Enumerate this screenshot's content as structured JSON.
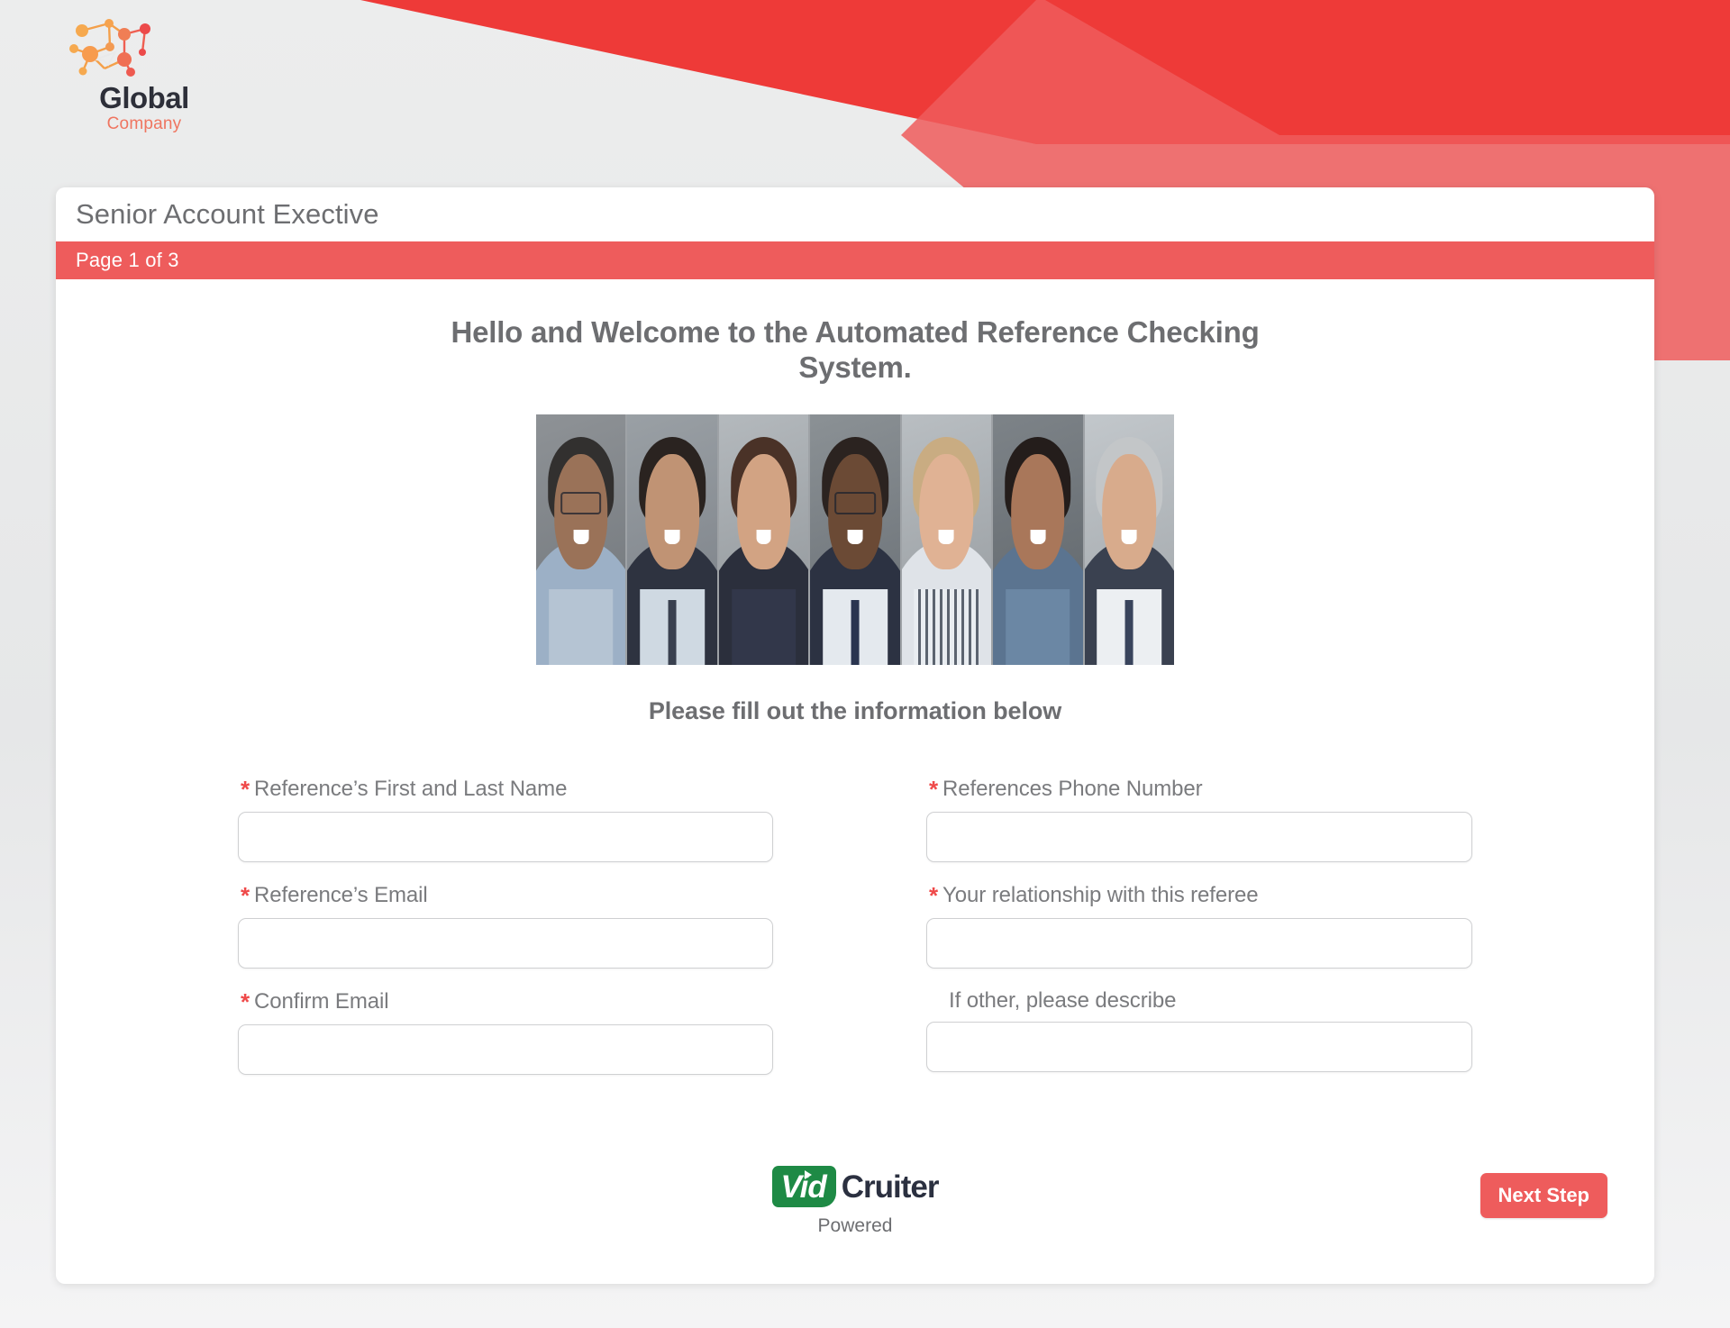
{
  "brand": {
    "logo_icon": "network-nodes-icon",
    "name_primary": "Global",
    "name_secondary": "Company",
    "primary_color": "#2d2f39",
    "secondary_color": "#ef7560"
  },
  "decor": {
    "banner_red": "#ee3a38",
    "banner_coral": "#ee5c5c"
  },
  "card": {
    "title": "Senior Account Exective",
    "page_indicator": "Page 1 of 3",
    "page_indicator_color": "#ee5c5c"
  },
  "content": {
    "welcome_heading": "Hello and Welcome to the Automated Reference Checking System.",
    "collage_alt": "portrait-collage",
    "fill_subheading": "Please fill out the information below"
  },
  "form": {
    "required_marker": "*",
    "fields": [
      {
        "name": "reference-name",
        "label": "Reference’s First and Last Name",
        "required": true,
        "value": "",
        "placeholder": ""
      },
      {
        "name": "reference-phone",
        "label": "References Phone Number",
        "required": true,
        "value": "",
        "placeholder": ""
      },
      {
        "name": "reference-email",
        "label": "Reference’s Email",
        "required": true,
        "value": "",
        "placeholder": ""
      },
      {
        "name": "relationship",
        "label": "Your relationship with this referee",
        "required": true,
        "value": "",
        "placeholder": ""
      },
      {
        "name": "confirm-email",
        "label": "Confirm Email",
        "required": true,
        "value": "",
        "placeholder": ""
      },
      {
        "name": "other-describe",
        "label": "If other, please describe",
        "required": false,
        "value": "",
        "placeholder": ""
      }
    ]
  },
  "footer": {
    "vidcruiter_vid": "Vid",
    "vidcruiter_cruiter": "Cruiter",
    "powered_label": "Powered",
    "vid_badge_color": "#1e8a45",
    "next_step_label": "Next Step",
    "next_step_color": "#ee5c5c"
  }
}
